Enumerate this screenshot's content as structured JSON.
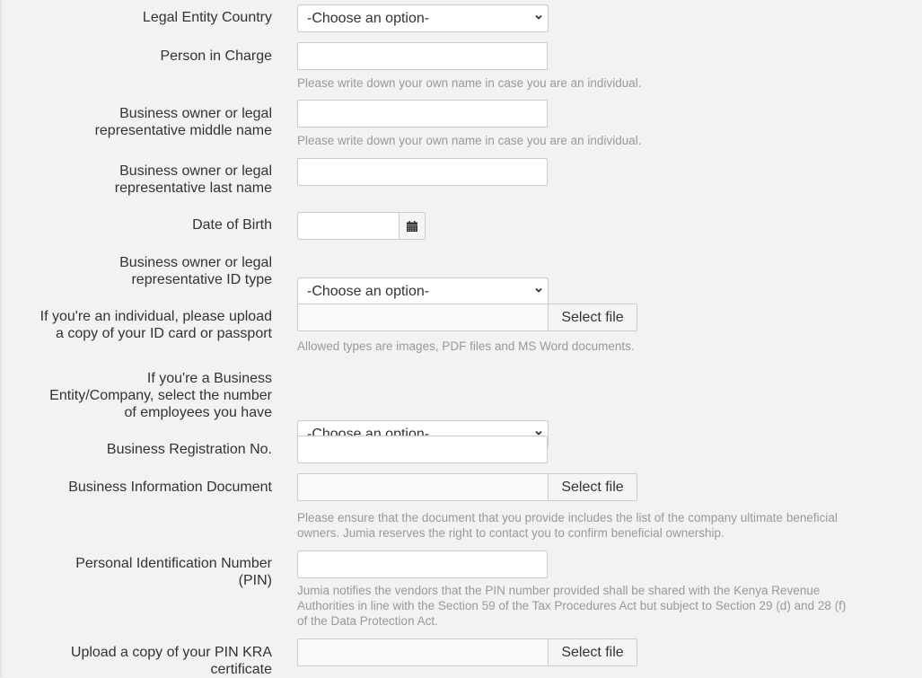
{
  "form": {
    "legal_entity_country": {
      "label": "Legal Entity Country",
      "value": "-Choose an option-"
    },
    "person_in_charge": {
      "label": "Person in Charge",
      "value": "",
      "help": "Please write down your own name in case you are an individual."
    },
    "middle_name": {
      "label_line1": "Business owner or legal",
      "label_line2": "representative middle name",
      "value": "",
      "help": "Please write down your own name in case you are an individual."
    },
    "last_name": {
      "label_line1": "Business owner or legal",
      "label_line2": "representative last name",
      "value": ""
    },
    "date_of_birth": {
      "label": "Date of Birth",
      "value": "",
      "icon": "calendar-icon"
    },
    "id_type": {
      "label_line1": "Business owner or legal",
      "label_line2": "representative ID type",
      "value": "-Choose an option-"
    },
    "id_upload": {
      "label_line1": "If you're an individual, please upload",
      "label_line2": "a copy of your ID card or passport",
      "button": "Select file",
      "help": "Allowed types are images, PDF files and MS Word documents."
    },
    "employees": {
      "label_line1": "If you're a Business",
      "label_line2": "Entity/Company, select the number",
      "label_line3": "of employees you have",
      "value": "-Choose an option-"
    },
    "registration_no": {
      "label": "Business Registration No.",
      "value": ""
    },
    "business_info_doc": {
      "label": "Business Information Document",
      "button": "Select file",
      "help_line1": "Please ensure that the document that you provide includes the list of the company ultimate beneficial",
      "help_line2": "owners. Jumia reserves the right to contact you to confirm beneficial ownership."
    },
    "pin": {
      "label_line1": "Personal Identification Number",
      "label_line2": "(PIN)",
      "value": "",
      "help_line1": "Jumia notifies the vendors that the PIN number provided shall be shared with the Kenya Revenue",
      "help_line2": "Authorities in line with the Section 59 of the Tax Procedures Act but subject to Section 29 (d) and 28 (f)",
      "help_line3": "of the Data Protection Act."
    },
    "pin_kra_upload": {
      "label_line1": "Upload a copy of your PIN KRA",
      "label_line2": "certificate",
      "button": "Select file"
    }
  }
}
